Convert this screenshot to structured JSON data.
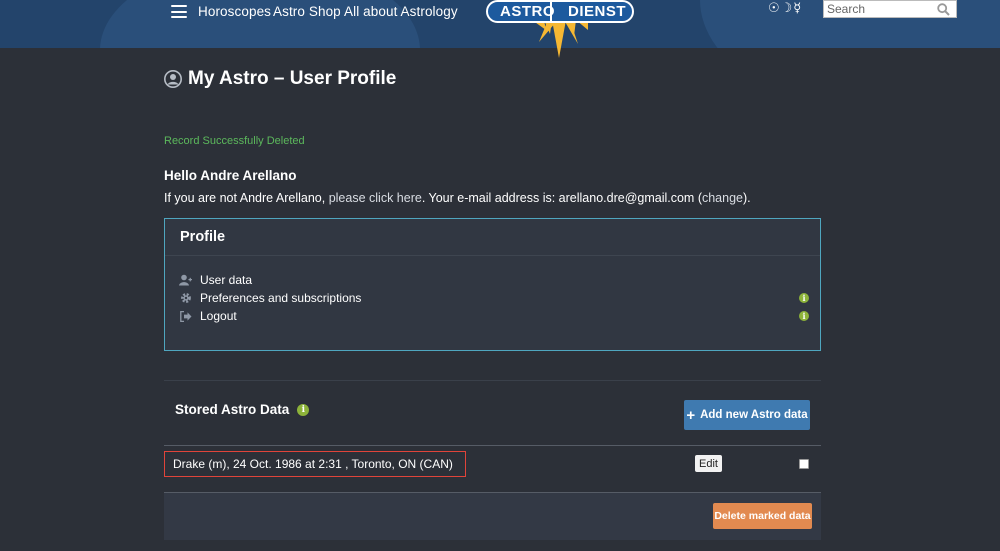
{
  "header": {
    "nav": [
      "Horoscopes",
      "Astro Shop",
      "All about Astrology"
    ],
    "logo": {
      "left": "ASTRO",
      "right": "DIENST"
    },
    "planet_symbols": "☉☽☿",
    "search_placeholder": "Search"
  },
  "page": {
    "title": "My Astro – User Profile",
    "status": "Record Successfully Deleted",
    "hello": "Hello Andre Arellano",
    "notice_1": "If you are not Andre Arellano, ",
    "notice_link": "please click here",
    "notice_2": ". Your e-mail address is: arellano.dre@gmail.com (",
    "notice_change": "change",
    "notice_3": ")."
  },
  "profile": {
    "title": "Profile",
    "items": [
      "User data",
      "Preferences and subscriptions",
      "Logout"
    ],
    "info_glyph": "i"
  },
  "stored": {
    "title": "Stored Astro Data",
    "add_label": "Add new Astro data",
    "record": "Drake (m), 24 Oct. 1986 at 2:31 , Toronto, ON (CAN)",
    "edit_label": "Edit",
    "delete_label": "Delete marked data"
  },
  "colors": {
    "header_bg": "#23446b",
    "page_bg": "#2c3038",
    "success": "#5cb85c",
    "accent_blue": "#3f7ab0",
    "danger_orange": "#e28a50",
    "highlight_red": "#e0443a"
  }
}
